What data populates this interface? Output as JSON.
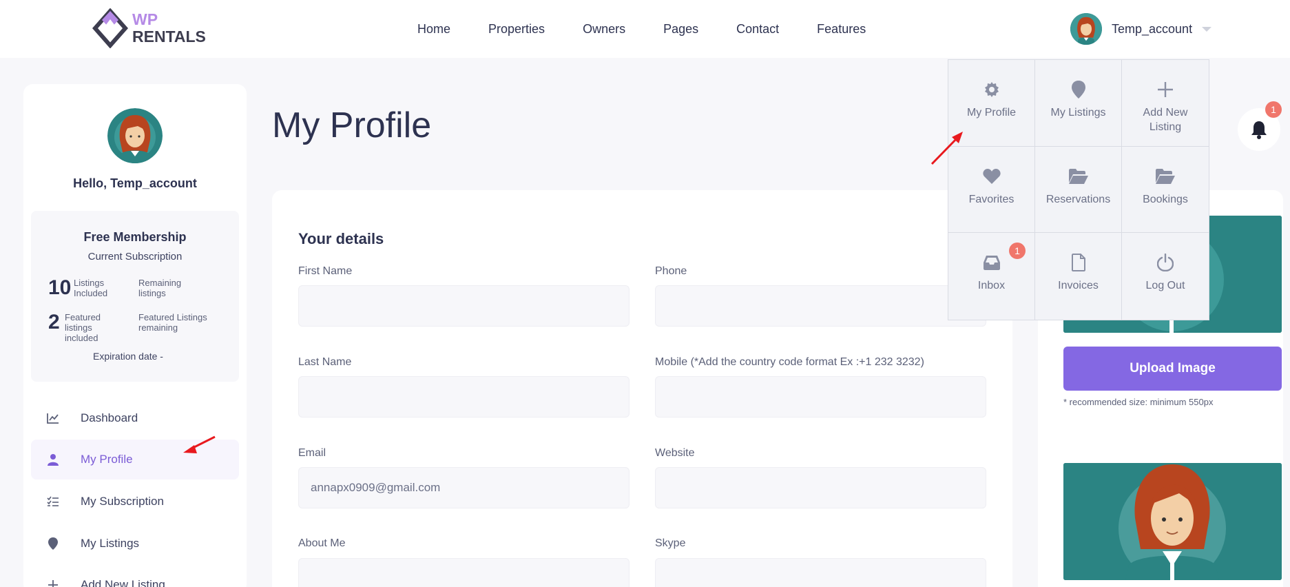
{
  "header": {
    "logo": {
      "line1": "WP",
      "line2": "RENTALS"
    },
    "nav": [
      "Home",
      "Properties",
      "Owners",
      "Pages",
      "Contact",
      "Features"
    ],
    "user_name": "Temp_account"
  },
  "sidebar": {
    "greeting": "Hello, Temp_account",
    "membership": {
      "title": "Free Membership",
      "subtitle": "Current Subscription",
      "listings_num": "10",
      "listings_label": "Listings Included",
      "remaining_label": "Remaining listings",
      "featured_num": "2",
      "featured_label": "Featured listings included",
      "featured_remaining_label": "Featured Listings remaining",
      "expiration": "Expiration date -"
    },
    "menu": [
      {
        "label": "Dashboard",
        "icon": "chart-icon"
      },
      {
        "label": "My Profile",
        "icon": "user-icon"
      },
      {
        "label": "My Subscription",
        "icon": "checklist-icon"
      },
      {
        "label": "My Listings",
        "icon": "map-pin-icon"
      },
      {
        "label": "Add New Listing",
        "icon": "plus-icon"
      }
    ]
  },
  "main": {
    "title": "My Profile",
    "notification_count": "1",
    "details": {
      "title": "Your details",
      "fields": {
        "first_name": {
          "label": "First Name",
          "value": ""
        },
        "phone": {
          "label": "Phone",
          "value": ""
        },
        "last_name": {
          "label": "Last Name",
          "value": ""
        },
        "mobile": {
          "label": "Mobile (*Add the country code format Ex :+1 232 3232)",
          "value": ""
        },
        "email": {
          "label": "Email",
          "value": "annapx0909@gmail.com"
        },
        "website": {
          "label": "Website",
          "value": ""
        },
        "about": {
          "label": "About Me",
          "value": ""
        },
        "skype": {
          "label": "Skype",
          "value": ""
        }
      }
    },
    "upload": {
      "button": "Upload Image",
      "note": "* recommended size: minimum 550px"
    }
  },
  "dropdown": {
    "items": [
      {
        "label": "My Profile",
        "icon": "gear-icon"
      },
      {
        "label": "My Listings",
        "icon": "map-pin-icon"
      },
      {
        "label": "Add New Listing",
        "icon": "plus-icon"
      },
      {
        "label": "Favorites",
        "icon": "heart-icon"
      },
      {
        "label": "Reservations",
        "icon": "folder-open-icon"
      },
      {
        "label": "Bookings",
        "icon": "folder-open-icon"
      },
      {
        "label": "Inbox",
        "icon": "inbox-icon",
        "badge": "1"
      },
      {
        "label": "Invoices",
        "icon": "document-icon"
      },
      {
        "label": "Log Out",
        "icon": "power-icon"
      }
    ]
  },
  "colors": {
    "accent": "#8468e3",
    "teal": "#2b8483",
    "badge": "#f0766b",
    "text": "#2d3250"
  }
}
